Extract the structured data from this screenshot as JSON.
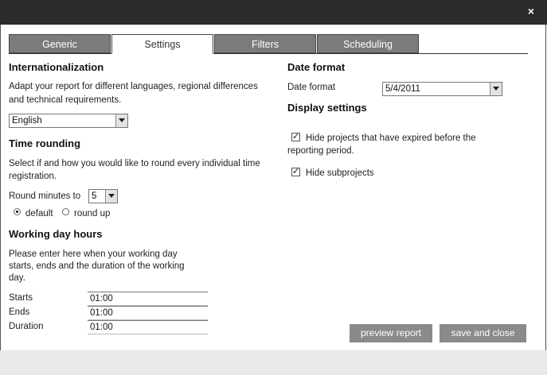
{
  "window": {
    "close_glyph": "×"
  },
  "tabs": [
    {
      "label": "Generic"
    },
    {
      "label": "Settings"
    },
    {
      "label": "Filters"
    },
    {
      "label": "Scheduling"
    }
  ],
  "internationalization": {
    "title": "Internationalization",
    "description_line1": "Adapt your report for different languages, regional differences",
    "description_line2": "and technical requirements.",
    "language_value": "English"
  },
  "time_rounding": {
    "title": "Time rounding",
    "description_line1": "Select if and how you would like to round every individual time",
    "description_line2": "registration.",
    "round_label": "Round minutes to",
    "round_value": "5",
    "option_default": "default",
    "option_round_up": "round up",
    "selected_option": "default"
  },
  "working_day": {
    "title": "Working day hours",
    "description_line1": "Please enter here when your working day",
    "description_line2": "starts, ends and the duration of the working",
    "description_line3": "day.",
    "starts_label": "Starts",
    "starts_value": "01:00",
    "ends_label": "Ends",
    "ends_value": "01:00",
    "duration_label": "Duration",
    "duration_value": "01:00"
  },
  "date_format": {
    "title": "Date format",
    "label": "Date format",
    "value": "5/4/2011"
  },
  "display_settings": {
    "title": "Display settings",
    "hide_expired_line1": "Hide projects that have expired before the",
    "hide_expired_line2": "reporting period.",
    "hide_expired_checked": true,
    "hide_subprojects": "Hide subprojects",
    "hide_subprojects_checked": true
  },
  "buttons": {
    "preview": "preview report",
    "save": "save and close"
  },
  "colors": {
    "titlebar": "#2b2b2b",
    "tab_inactive": "#7b7b7b",
    "button": "#8a8a8a",
    "footer": "#e9e9e9"
  }
}
